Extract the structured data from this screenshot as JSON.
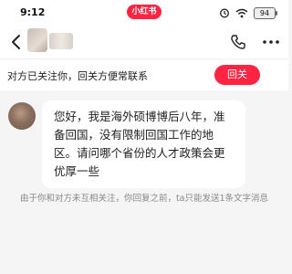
{
  "status_bar": {
    "time": "9:12",
    "app_badge": "小红书",
    "battery": "94"
  },
  "nav": {
    "back_icon": "chevron-left-icon",
    "call_icon": "phone-icon",
    "more_icon": "more-horizontal-icon"
  },
  "follow_bar": {
    "text": "对方已关注你，回关方便常联系",
    "button_label": "回关",
    "button_color": "#ff2442"
  },
  "conversation": {
    "message": "您好，我是海外硕博博后八年，准备回国，没有限制回国工作的地区。请问哪个省份的人才政策会更优厚一些",
    "system_note": "由于你和对方未互相关注，你回复之前，ta只能发送1条文字消息"
  }
}
